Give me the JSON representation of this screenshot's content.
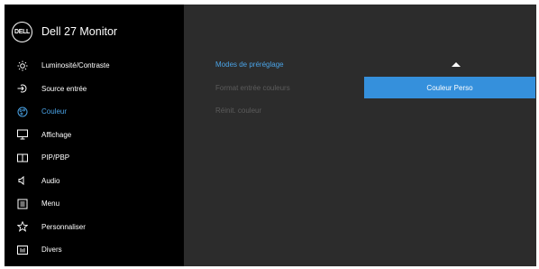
{
  "header": {
    "logo_text": "DELL",
    "model": "Dell 27 Monitor"
  },
  "menu": [
    {
      "label": "Luminosité/Contraste",
      "icon": "brightness-icon",
      "active": false
    },
    {
      "label": "Source entrée",
      "icon": "input-source-icon",
      "active": false
    },
    {
      "label": "Couleur",
      "icon": "color-palette-icon",
      "active": true
    },
    {
      "label": "Affichage",
      "icon": "display-icon",
      "active": false
    },
    {
      "label": "PIP/PBP",
      "icon": "pip-pbp-icon",
      "active": false
    },
    {
      "label": "Audio",
      "icon": "speaker-icon",
      "active": false
    },
    {
      "label": "Menu",
      "icon": "menu-list-icon",
      "active": false
    },
    {
      "label": "Personnaliser",
      "icon": "star-icon",
      "active": false
    },
    {
      "label": "Divers",
      "icon": "others-icon",
      "active": false
    }
  ],
  "submenu": [
    {
      "label": "Modes de préréglage",
      "active": true
    },
    {
      "label": "Format entrée couleurs",
      "active": false
    },
    {
      "label": "Réinit. couleur",
      "active": false
    }
  ],
  "value": {
    "selected": "Couleur Perso"
  },
  "colors": {
    "accent": "#4aa3e6",
    "panel": "#3590dc",
    "background": "#2c2c2c",
    "sidebar": "#000000"
  }
}
